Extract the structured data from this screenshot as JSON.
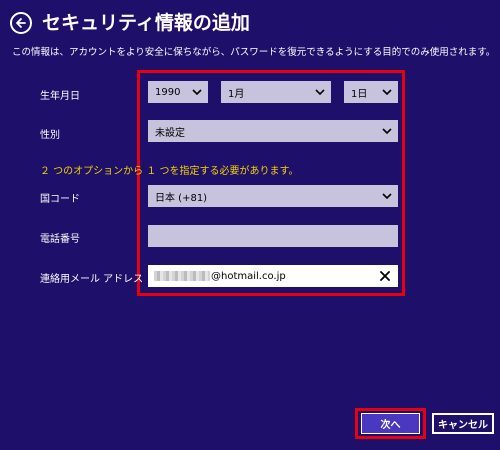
{
  "header": {
    "back_icon": "back-arrow-icon",
    "title": "セキュリティ情報の追加"
  },
  "description": "この情報は、アカウントをより安全に保ちながら、パスワードを復元できるようにする目的でのみ使用されます。",
  "form": {
    "birthdate": {
      "label": "生年月日",
      "year": "1990",
      "month": "1月",
      "day": "1日"
    },
    "gender": {
      "label": "性別",
      "value": "未設定"
    },
    "option_note": "２ つのオプションから １ つを指定する必要があります。",
    "country": {
      "label": "国コード",
      "value": "日本 (+81)"
    },
    "phone": {
      "label": "電話番号",
      "value": ""
    },
    "email": {
      "label": "連絡用メール アドレス",
      "value": "@hotmail.co.jp",
      "clear_icon": "close-icon"
    }
  },
  "buttons": {
    "next": "次へ",
    "cancel": "キャンセル"
  },
  "colors": {
    "background": "#1e0f6a",
    "highlight": "#e50012",
    "note": "#f2d200",
    "field": "#c8c3dc",
    "primary_button": "#4a39c0"
  }
}
